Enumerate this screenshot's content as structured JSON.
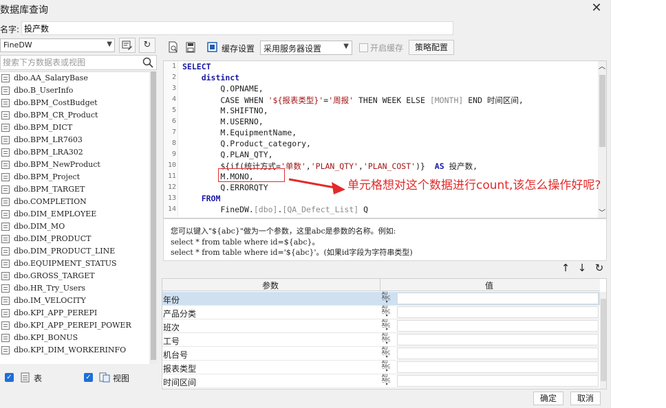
{
  "dialog": {
    "title": "数据库查询",
    "name_label": "名字:",
    "name_value": "投产数"
  },
  "left": {
    "db_selected": "FineDW",
    "search_placeholder": "搜索下方数据表或视图",
    "tables": [
      "dbo.AA_SalaryBase",
      "dbo.B_UserInfo",
      "dbo.BPM_CostBudget",
      "dbo.BPM_CR_Product",
      "dbo.BPM_DICT",
      "dbo.BPM_LR7603",
      "dbo.BPM_LRA302",
      "dbo.BPM_NewProduct",
      "dbo.BPM_Project",
      "dbo.BPM_TARGET",
      "dbo.COMPLETION",
      "dbo.DIM_EMPLOYEE",
      "dbo.DIM_MO",
      "dbo.DIM_PRODUCT",
      "dbo.DIM_PRODUCT_LINE",
      "dbo.EQUIPMENT_STATUS",
      "dbo.GROSS_TARGET",
      "dbo.HR_Try_Users",
      "dbo.IM_VELOCITY",
      "dbo.KPI_APP_PEREPI",
      "dbo.KPI_APP_PEREPI_POWER",
      "dbo.KPI_BONUS",
      "dbo.KPI_DIM_WORKERINFO"
    ],
    "table_checkbox_label": "表",
    "view_checkbox_label": "视图"
  },
  "toolbar": {
    "cache_label": "缓存设置",
    "cache_option": "采用服务器设置",
    "enable_cache_label": "开启缓存",
    "policy_button": "策略配置"
  },
  "editor": {
    "line_numbers": [
      "1",
      "2",
      "3",
      "4",
      "5",
      "6",
      "7",
      "8",
      "9",
      "10",
      "11",
      "12",
      "13",
      "14"
    ]
  },
  "hint": {
    "line1": "您可以键入\"${abc}\"做为一个参数，这里abc是参数的名称。例如:",
    "line2": "select * from table where id=${abc}。",
    "line3": "select * from table where id='${abc}'。(如果id字段为字符串类型)"
  },
  "params": {
    "header_param": "参数",
    "header_value": "值",
    "rows": [
      "年份",
      "产品分类",
      "班次",
      "工号",
      "机台号",
      "报表类型",
      "时间区间"
    ]
  },
  "footer": {
    "ok": "确定",
    "cancel": "取消"
  },
  "annotation": {
    "text": "单元格想对这个数据进行count,该怎么操作好呢?"
  },
  "colors": {
    "annotation": "#e32a2a",
    "keyword": "#1a1aa6",
    "string": "#a31515",
    "checkbox": "#1e6fd9",
    "selected_row": "#cfe0f1"
  }
}
